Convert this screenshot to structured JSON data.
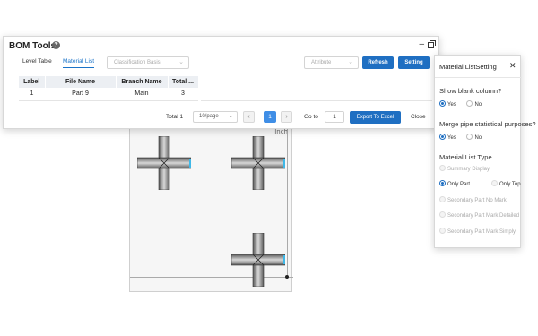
{
  "bom": {
    "title": "BOM Tools",
    "help_icon": "?",
    "minimize_label": "–",
    "tabs": [
      "Level Table",
      "Material List"
    ],
    "classification_placeholder": "Classification Basis",
    "attribute_placeholder": "Attribute",
    "refresh_label": "Refresh",
    "setting_label": "Setting",
    "table": {
      "headers": [
        "Label",
        "File Name",
        "Branch Name",
        "Total ..."
      ],
      "rows": [
        [
          "1",
          "Part 9",
          "Main",
          "3"
        ]
      ]
    },
    "pager": {
      "total": "Total 1",
      "page_size": "10/page",
      "prev": "‹",
      "current": "1",
      "next": "›",
      "goto_label": "Go to",
      "goto_value": "1"
    },
    "export_label": "Export To Excel",
    "close_label": "Close"
  },
  "setting": {
    "title": "Material ListSetting",
    "close_icon": "✕",
    "show_blank_q": "Show blank column?",
    "merge_q": "Merge pipe statistical purposes?",
    "yes": "Yes",
    "no": "No",
    "type_q": "Material List Type",
    "types": [
      "Summary Display",
      "Only Part",
      "Only Top",
      "Secondary Part No Mark",
      "Secondary Part Mark Detailed",
      "Secondary Part Mark Simply"
    ]
  },
  "canvas": {
    "corner_label": "Inch"
  },
  "colors": {
    "accent": "#1f6fc2",
    "pager_active": "#3f8ee6"
  }
}
